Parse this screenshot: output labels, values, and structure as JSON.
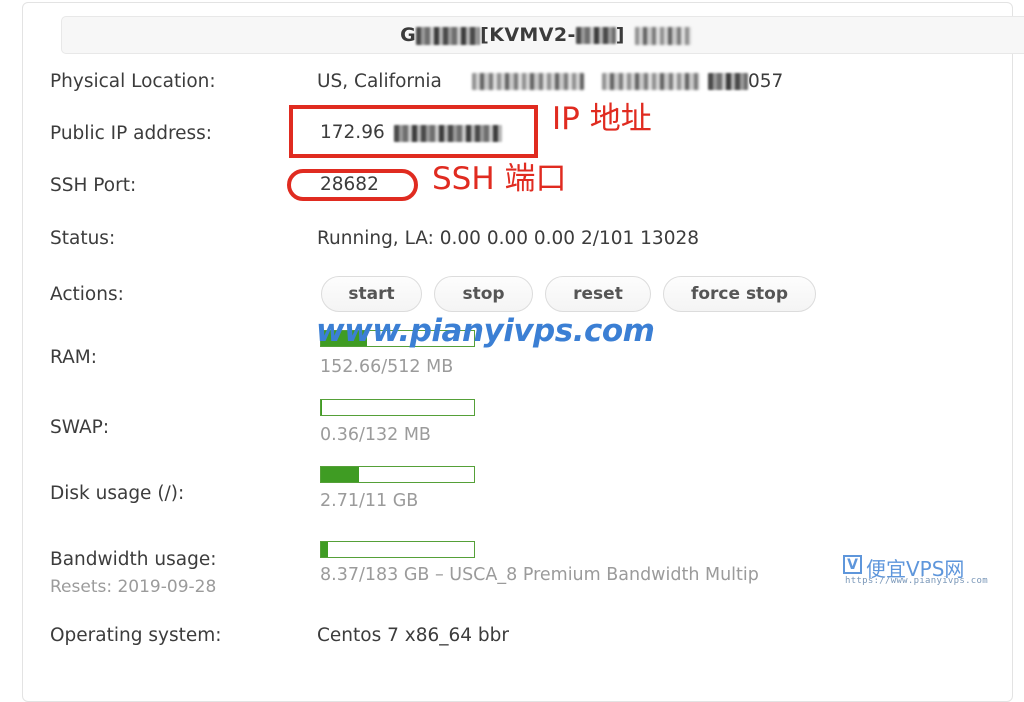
{
  "panel": {
    "header_title_prefix": "G",
    "header_title_middle": "[KVMV2-",
    "header_title_suffix": "]",
    "header_redacted": true
  },
  "rows": {
    "physical_location": {
      "label": "Physical Location:",
      "value": "US, California",
      "extra_redacted_tail": "057"
    },
    "public_ip": {
      "label": "Public IP address:",
      "value_visible": "172.96",
      "redacted": true
    },
    "ssh_port": {
      "label": "SSH Port:",
      "value": "28682"
    },
    "status": {
      "label": "Status:",
      "value": "Running, LA: 0.00 0.00 0.00 2/101 13028"
    },
    "actions": {
      "label": "Actions:",
      "buttons": [
        {
          "label": "start",
          "name": "start-button"
        },
        {
          "label": "stop",
          "name": "stop-button"
        },
        {
          "label": "reset",
          "name": "reset-button"
        },
        {
          "label": "force stop",
          "name": "force-stop-button"
        }
      ]
    },
    "ram": {
      "label": "RAM:",
      "usage_text": "152.66/512 MB",
      "used": 152.66,
      "total": 512,
      "percent": 29.8
    },
    "swap": {
      "label": "SWAP:",
      "usage_text": "0.36/132 MB",
      "used": 0.36,
      "total": 132,
      "percent": 0.3
    },
    "disk": {
      "label": "Disk usage (/):",
      "usage_text": "2.71/11 GB",
      "used": 2.71,
      "total": 11,
      "percent": 24.6
    },
    "bandwidth": {
      "label": "Bandwidth usage:",
      "reset_label": "Resets: 2019-09-28",
      "usage_text": "8.37/183 GB – USCA_8 Premium Bandwidth Multip",
      "used": 8.37,
      "total": 183,
      "percent": 4.6
    },
    "operating_system": {
      "label": "Operating system:",
      "value": "Centos 7 x86_64 bbr"
    }
  },
  "annotations": {
    "ip_note": "IP 地址",
    "ssh_note": "SSH 端口",
    "color": "#e02b20"
  },
  "watermarks": {
    "center": "www.pianyivps.com",
    "corner_badge": "V",
    "corner_name": "便宜VPS网",
    "corner_url": "https://www.pianyivps.com",
    "color": "#3b7fd4"
  }
}
